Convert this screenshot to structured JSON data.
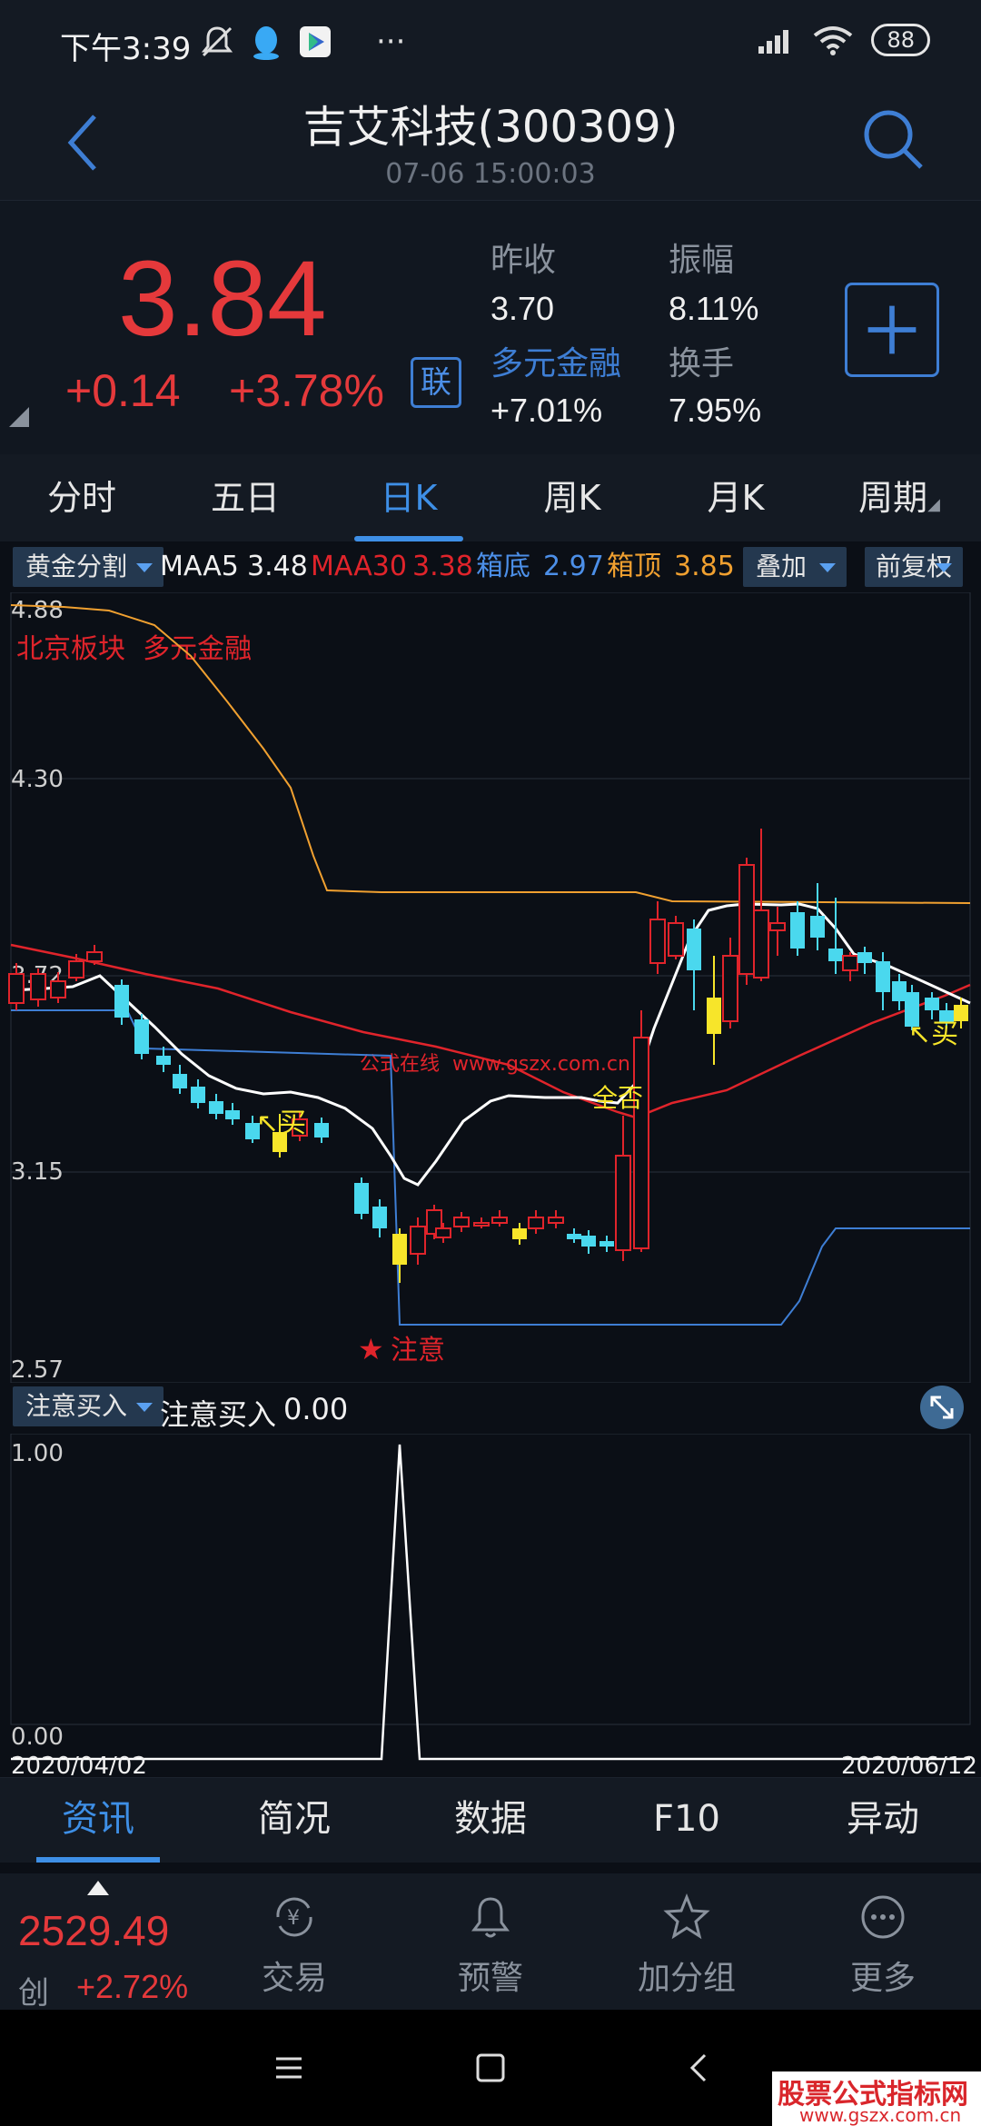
{
  "status_bar": {
    "time": "下午3:39",
    "battery": "88"
  },
  "header": {
    "title": "吉艾科技(300309)",
    "subtitle": "07-06 15:00:03"
  },
  "quote": {
    "price": "3.84",
    "change": "+0.14",
    "change_pct": "+3.78%",
    "lian_label": "联",
    "stats": [
      {
        "label": "昨收",
        "value": "3.70"
      },
      {
        "label": "振幅",
        "value": "8.11%"
      },
      {
        "label": "多元金融",
        "value": "+7.01%"
      },
      {
        "label": "换手",
        "value": "7.95%"
      }
    ]
  },
  "period_tabs": [
    "分时",
    "五日",
    "日K",
    "周K",
    "月K",
    "周期"
  ],
  "indicator_bar": {
    "indicator": "黄金分割",
    "ma5_label": "MAA5",
    "ma5_value": "3.48",
    "ma30_label": "MAA30",
    "ma30_value": "3.38",
    "box_bottom_label": "箱底",
    "box_bottom_value": "2.97",
    "box_top_label": "箱顶",
    "box_top_value": "3.85",
    "overlay": "叠加",
    "adjust": "前复权"
  },
  "main_chart": {
    "y_labels": [
      "4.88",
      "4.30",
      "3.72",
      "3.15",
      "2.57"
    ],
    "tags": "北京板块  多元金融",
    "watermark": "公式在线  www.gszx.com.cn",
    "signals": {
      "buy": "买",
      "buy_arrow": "↖买",
      "attention": "注意",
      "strong": "全否"
    }
  },
  "sub_chart": {
    "indicator": "注意买入",
    "title": "注意买入",
    "value": "0.00",
    "y_labels": [
      "1.00",
      "0.00"
    ],
    "date_start": "2020/04/02",
    "date_end": "2020/06/12"
  },
  "bottom_tabs": [
    "资讯",
    "简况",
    "数据",
    "F10",
    "异动"
  ],
  "toolbar": {
    "index_value": "2529.49",
    "index_name": "创",
    "index_pct": "+2.72%",
    "tools": [
      "交易",
      "预警",
      "加分组",
      "更多"
    ]
  },
  "watermark": {
    "line1": "股票公式指标网",
    "line2": "www.gszx.com.cn"
  },
  "colors": {
    "up": "#e5393b",
    "down": "#4ad8ee",
    "accent": "#3e8fe6",
    "ma5": "#ffffff",
    "ma30": "#e0242b",
    "box_top": "#f0a030",
    "box_bottom": "#3e7ed4",
    "highlight": "#f7e52a"
  }
}
